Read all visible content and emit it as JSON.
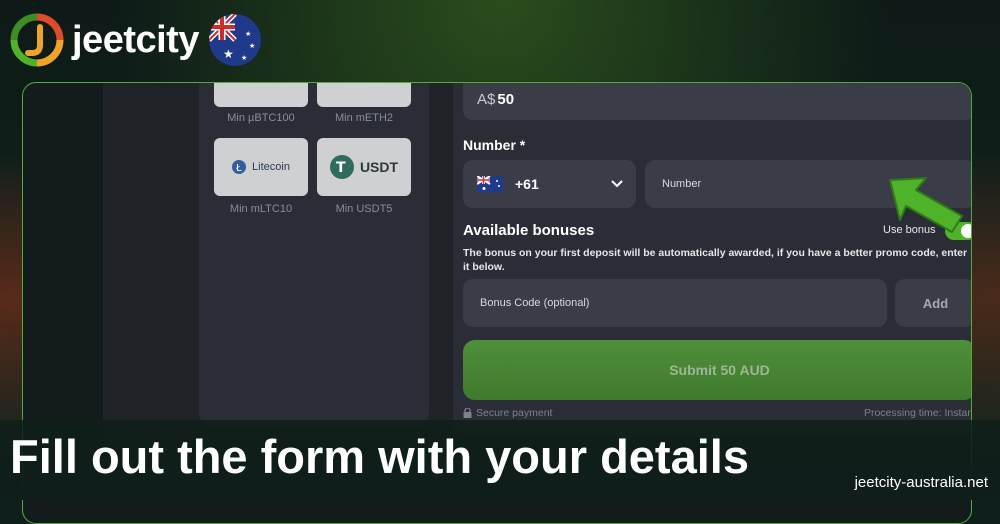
{
  "brand": {
    "name": "jeetcity",
    "logo_colors": [
      "#4fb32a",
      "#f0a424",
      "#e04a2c"
    ]
  },
  "crypto_options": [
    {
      "name": "",
      "min": "Min µBTC100"
    },
    {
      "name": "",
      "min": "Min mETH2"
    },
    {
      "name": "Litecoin",
      "min": "Min mLTC10"
    },
    {
      "name": "USDT",
      "min": "Min USDT5"
    }
  ],
  "form": {
    "amount_currency": "A$",
    "amount_value": "50",
    "number_label": "Number *",
    "country_code": "+61",
    "number_placeholder": "Number",
    "bonuses_title": "Available bonuses",
    "use_bonus_label": "Use bonus",
    "use_bonus_on": true,
    "bonus_description": "The bonus on your first deposit will be automatically awarded, if you have a better promo code, enter it below.",
    "promo_placeholder": "Bonus Code (optional)",
    "add_label": "Add",
    "submit_label": "Submit 50 AUD",
    "secure_label": "Secure payment",
    "processing_label": "Processing time: Instant"
  },
  "caption": "Fill out the form with your details",
  "site": "jeetcity-australia.net",
  "colors": {
    "accent": "#4fb32a",
    "panel": "#2a2d35",
    "field": "#3a3d48"
  }
}
